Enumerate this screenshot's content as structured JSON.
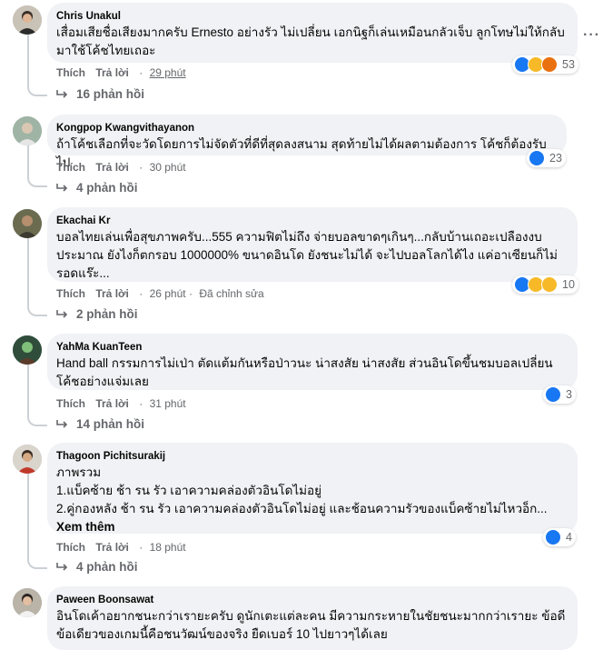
{
  "comments": [
    {
      "author": "Chris Unakul",
      "text": "เสื่อมเสียชื่อเสียงมากครับ Ernesto อย่างรัว ไม่เปลี่ยน เอกนิฐก็เล่นเหมือนกลัวเจ็บ ลูกโทษไม่ให้กลับมาใช้โค้ชไทยเถอะ",
      "like": "Thích",
      "reply": "Trả lời",
      "time": "29 phút",
      "reaction_count": "53",
      "replies": "16 phản hồi"
    },
    {
      "author": "Kongpop Kwangvithayanon",
      "text": "ถ้าโค้ชเลือกที่จะวัดโดยการไม่จัดตัวที่ดีที่สุดลงสนาม สุดท้ายไม่ได้ผลตามต้องการ โค้ชก็ต้องรับไป",
      "like": "Thích",
      "reply": "Trả lời",
      "time": "30 phút",
      "reaction_count": "23",
      "replies": "4 phản hồi"
    },
    {
      "author": "Ekachai Kr",
      "text": "บอลไทยเล่นเพื่อสุขภาพครับ...555 ความฟิตไม่ถึง จ่ายบอลขาดๆเกินๆ...กลับบ้านเถอะเปลืองงบประมาณ ยังไงก็ตกรอบ 1000000% ขนาดอินโด ยังชนะไม่ได้ จะไปบอลโลกได้ไง แค่อาเซียนก็ไม่รอดแร๊ะ...",
      "like": "Thích",
      "reply": "Trả lời",
      "time": "26 phút",
      "edited": "Đã chỉnh sửa",
      "reaction_count": "10",
      "replies": "2 phản hồi"
    },
    {
      "author": "YahMa KuanTeen",
      "text": "Hand ball กรรมการไม่เป่า ตัดแต้มกันหรือป่าวนะ น่าสงสัย น่าสงสัย ส่วนอินโดขึ้นชมบอลเปลี่ยนโค้ชอย่างแจ่มเลย",
      "like": "Thích",
      "reply": "Trả lời",
      "time": "31 phút",
      "reaction_count": "3",
      "replies": "14 phản hồi"
    },
    {
      "author": "Thagoon Pichitsurakij",
      "text_lines": [
        "ภาพรวม",
        "1.แบ็คซ้าย ช้า รน รัว เอาความคล่องตัวอินโดไม่อยู่",
        "2.คู่กองหลัง ช้า รน รัว เอาความคล่องตัวอินโดไม่อยู่ และช้อนความรัวของแบ็คซ้ายไม่ไหวอ็ก..."
      ],
      "see_more": "Xem thêm",
      "like": "Thích",
      "reply": "Trả lời",
      "time": "18 phút",
      "reaction_count": "4",
      "replies": "4 phản hồi"
    },
    {
      "author": "Paween Boonsawat",
      "text": "อินโดเค้าอยากชนะกว่าเรายะครับ ดูนักเตะแต่ละคน มีความกระหายในชัยชนะมากกว่าเรายะ ข้อดีข้อเดียวของเกมนี้คือชนวัฒน์ของจริง ยืดเบอร์ 10 ไปยาวๆได้เลย"
    }
  ],
  "colors": {
    "like_blue": "#1877f2",
    "haha_yellow": "#f7b928",
    "angry_orange": "#e9710f",
    "bubble_bg": "#f0f2f5",
    "meta_grey": "#65676b"
  },
  "icons": [
    "more-options-icon",
    "reply-arrow-icon",
    "like-reaction-icon",
    "haha-reaction-icon",
    "angry-reaction-icon"
  ]
}
